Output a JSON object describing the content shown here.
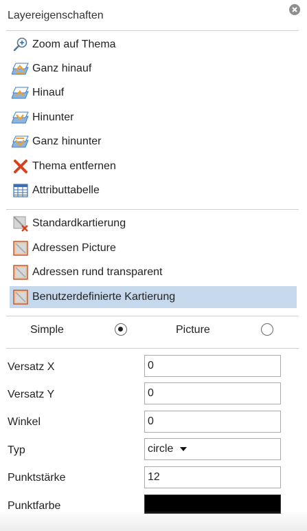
{
  "panel": {
    "title": "Layereigenschaften"
  },
  "menu": {
    "zoom": "Zoom auf Thema",
    "top": "Ganz hinauf",
    "up": "Hinauf",
    "down": "Hinunter",
    "bottom": "Ganz hinunter",
    "remove": "Thema entfernen",
    "table": "Attributtabelle"
  },
  "mapping": {
    "standard": "Standardkartierung",
    "picture": "Adressen Picture",
    "round": "Adressen rund transparent",
    "custom": "Benutzerdefinierte Kartierung",
    "selected": "custom"
  },
  "style_mode": {
    "simple_label": "Simple",
    "picture_label": "Picture",
    "selected": "Simple"
  },
  "form": {
    "offset_x_label": "Versatz X",
    "offset_x_value": "0",
    "offset_y_label": "Versatz Y",
    "offset_y_value": "0",
    "angle_label": "Winkel",
    "angle_value": "0",
    "type_label": "Typ",
    "type_value": "circle",
    "size_label": "Punktstärke",
    "size_value": "12",
    "color_label": "Punktfarbe",
    "color_value": "#000000"
  },
  "colors": {
    "selection_bg": "#c6d9ec",
    "remove_x": "#d9401e",
    "arrow_blue": "#3b7fc9",
    "arrow_orange": "#f0a030"
  }
}
